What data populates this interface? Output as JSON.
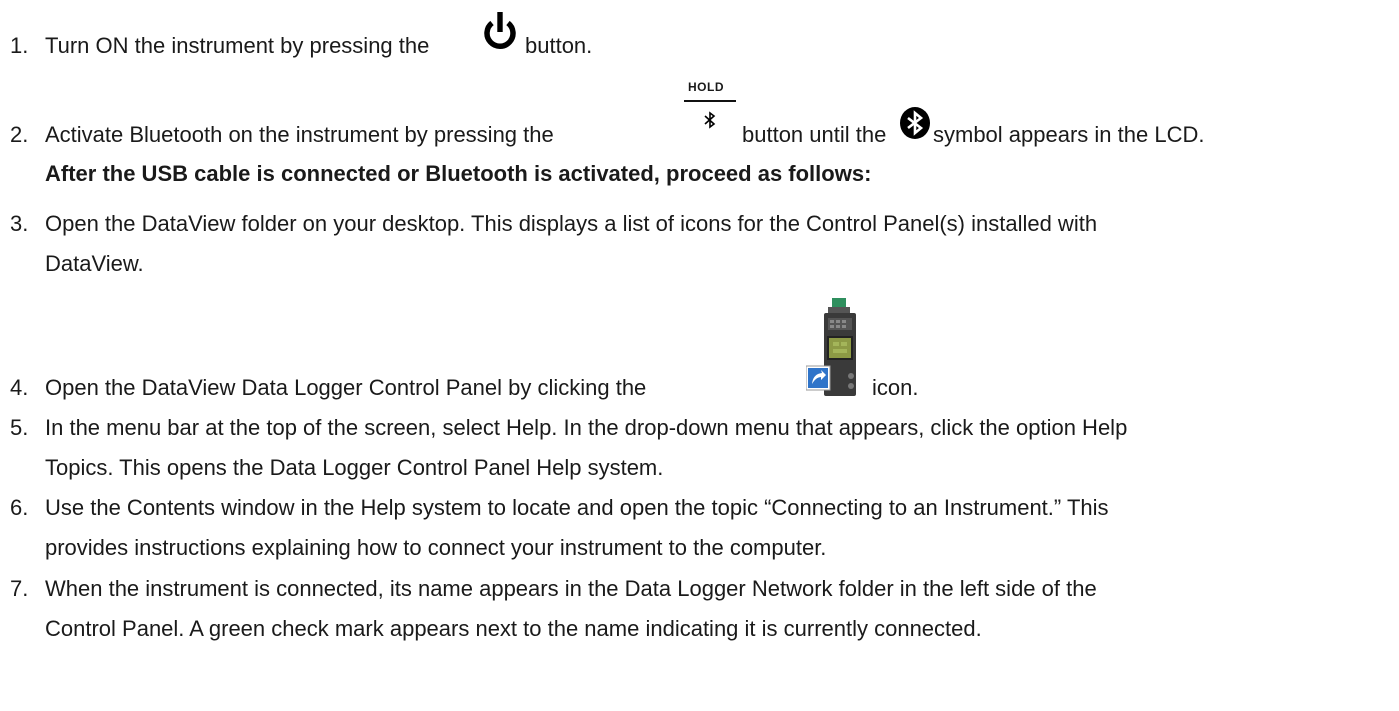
{
  "steps": [
    {
      "num": "1.",
      "before": "Turn ON the instrument by pressing the",
      "after": "button."
    },
    {
      "num": "2.",
      "before": "Activate Bluetooth on the instrument by pressing the",
      "middle": "button until the",
      "after": "symbol appears in the LCD.",
      "hold_label": "HOLD"
    },
    {
      "num": "3.",
      "line1": "Open the DataView folder on your desktop. This displays a list of icons for the Control Panel(s) installed with",
      "line2": "DataView."
    },
    {
      "num": "4.",
      "before": "Open the DataView Data Logger Control Panel by clicking the",
      "after": "icon."
    },
    {
      "num": "5.",
      "line1": "In the menu bar at the top of the screen, select Help. In the drop-down menu that appears, click the option Help",
      "line2": "Topics. This opens the Data Logger Control Panel Help system."
    },
    {
      "num": "6.",
      "line1": "Use the Contents window in the Help system to locate and open the topic “Connecting to an Instrument.” This",
      "line2": "provides instructions explaining how to connect your instrument to the computer."
    },
    {
      "num": "7.",
      "line1": "When the instrument is connected, its name appears in the Data Logger Network folder in the left side of the",
      "line2": "Control Panel. A green check mark appears next to the name indicating it is currently connected."
    }
  ],
  "subheading": "After the USB cable is connected or Bluetooth is activated, proceed as follows:",
  "icons": {
    "power": "power-icon",
    "bluetooth_button": "bluetooth-icon",
    "bluetooth_symbol": "bluetooth-symbol-icon",
    "data_logger": "data-logger-shortcut-icon"
  }
}
